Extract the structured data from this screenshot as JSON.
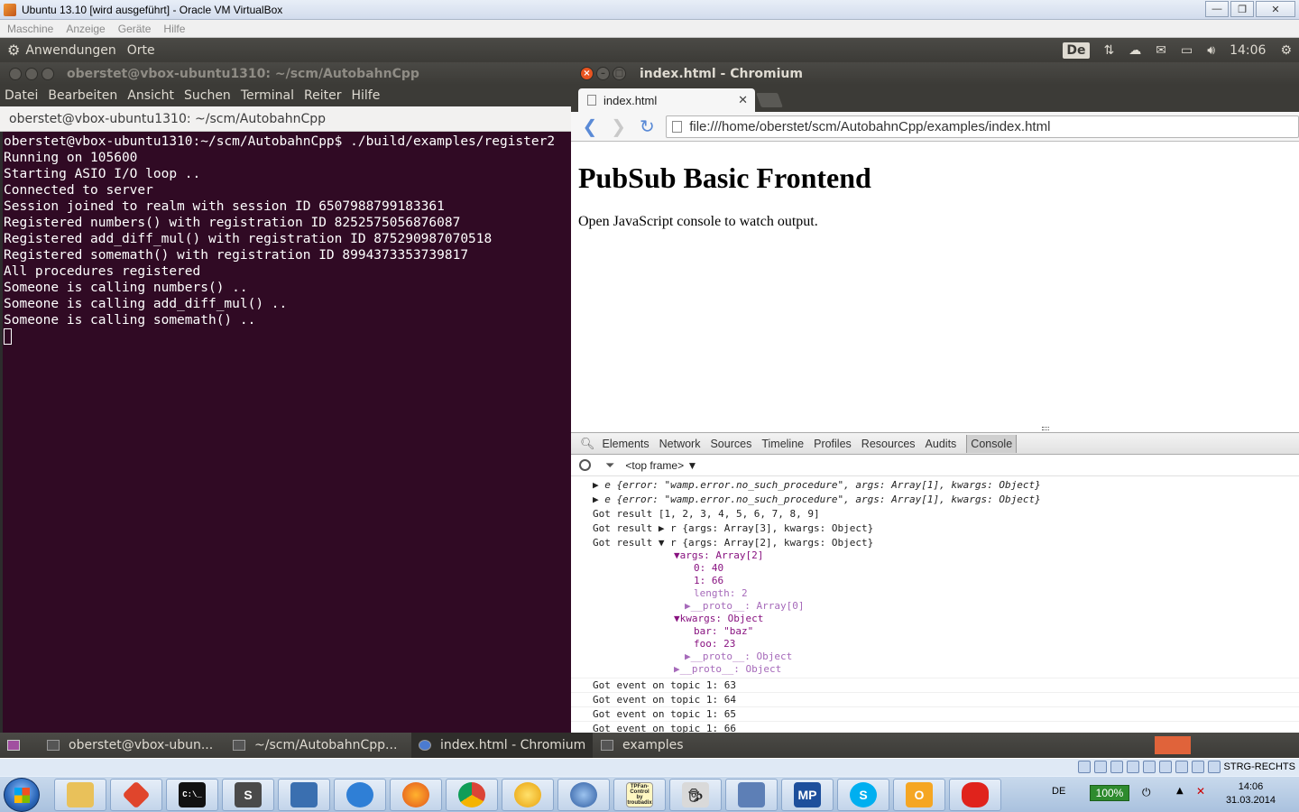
{
  "host": {
    "window_title": "Ubuntu 13.10 [wird ausgeführt] - Oracle VM VirtualBox",
    "menu": [
      "Maschine",
      "Anzeige",
      "Geräte",
      "Hilfe"
    ]
  },
  "ubuntu_panel": {
    "menus": [
      "Anwendungen",
      "Orte"
    ],
    "keyboard": "De",
    "clock": "14:06"
  },
  "terminal": {
    "title": "oberstet@vbox-ubuntu1310: ~/scm/AutobahnCpp",
    "menu": [
      "Datei",
      "Bearbeiten",
      "Ansicht",
      "Suchen",
      "Terminal",
      "Reiter",
      "Hilfe"
    ],
    "tab": "oberstet@vbox-ubuntu1310: ~/scm/AutobahnCpp",
    "lines": [
      "oberstet@vbox-ubuntu1310:~/scm/AutobahnCpp$ ./build/examples/register2",
      "Running on 105600",
      "Starting ASIO I/O loop ..",
      "Connected to server",
      "Session joined to realm with session ID 6507988799183361",
      "Registered numbers() with registration ID 8252575056876087",
      "Registered add_diff_mul() with registration ID 875290987070518",
      "Registered somemath() with registration ID 8994373353739817",
      "All procedures registered",
      "Someone is calling numbers() ..",
      "Someone is calling add_diff_mul() ..",
      "Someone is calling somemath() .."
    ]
  },
  "chromium": {
    "title": "index.html - Chromium",
    "tab": "index.html",
    "url": "file:///home/oberstet/scm/AutobahnCpp/examples/index.html",
    "page_heading": "PubSub Basic Frontend",
    "page_text": "Open JavaScript console to watch output."
  },
  "devtools": {
    "tabs": [
      "Elements",
      "Network",
      "Sources",
      "Timeline",
      "Profiles",
      "Resources",
      "Audits",
      "Console"
    ],
    "frame": "<top frame>",
    "console": {
      "err1": "e {error: \"wamp.error.no_such_procedure\", args: Array[1], kwargs: Object}",
      "err2": "e {error: \"wamp.error.no_such_procedure\", args: Array[1], kwargs: Object}",
      "res1": "Got result [1, 2, 3, 4, 5, 6, 7, 8, 9]",
      "res2": "Got result ▶ r {args: Array[3], kwargs: Object}",
      "res3": "Got result ▼ r {args: Array[2], kwargs: Object}",
      "args": "▼args: Array[2]",
      "a0": "0: 40",
      "a1": "1: 66",
      "alen": "length: 2",
      "aproto": "▶__proto__: Array[0]",
      "kwargs": "▼kwargs: Object",
      "bar": "bar: \"baz\"",
      "foo": "foo: 23",
      "kproto": "▶__proto__: Object",
      "rproto": "▶__proto__: Object",
      "ev63": "Got event on topic 1: 63",
      "ev64": "Got event on topic 1: 64",
      "ev65": "Got event on topic 1: 65",
      "ev66": "Got event on topic 1: 66"
    }
  },
  "bottom_panel": {
    "items": [
      "oberstet@vbox-ubun...",
      "~/scm/AutobahnCpp...",
      "index.html - Chromium",
      "examples"
    ]
  },
  "windows_taskbar": {
    "tray_label": "STRG-RECHTS",
    "lang": "DE",
    "battery": "100%",
    "time": "14:06",
    "date": "31.03.2014",
    "app_tiles": [
      "C:\\_",
      "S",
      "MP",
      "TPFan-Control by troubadix"
    ]
  }
}
